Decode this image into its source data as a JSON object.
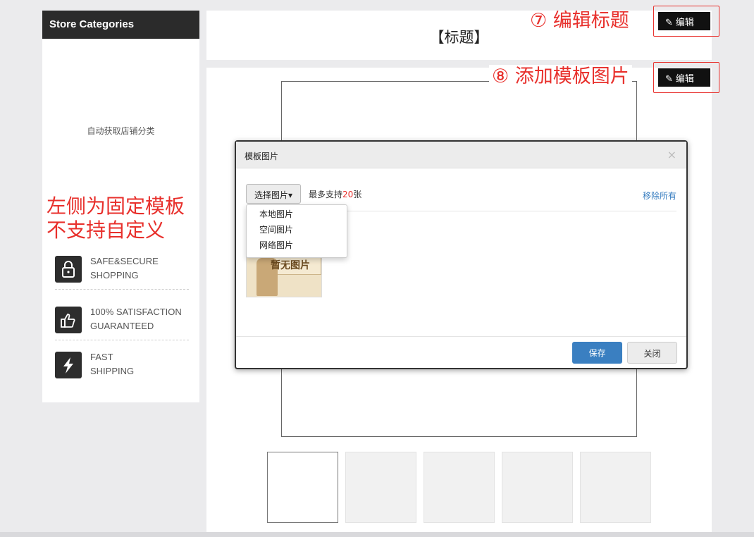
{
  "sidebar": {
    "header": "Store Categories",
    "auto_text": "自动获取店铺分类",
    "features": [
      {
        "line1": "SAFE&SECURE",
        "line2": "SHOPPING",
        "icon": "lock-icon"
      },
      {
        "line1": "100% SATISFACTION",
        "line2": "GUARANTEED",
        "icon": "thumbs-up-icon"
      },
      {
        "line1": "FAST",
        "line2": "SHIPPING",
        "icon": "lightning-icon"
      }
    ]
  },
  "annotations": {
    "left_note_line1": "左侧为固定模板",
    "left_note_line2": "不支持自定义",
    "edit_title_note": "⑦ 编辑标题",
    "add_image_note": "⑧ 添加模板图片"
  },
  "main": {
    "title": "【标题】",
    "edit_label": "编辑",
    "thumbnail_count": 5
  },
  "modal": {
    "title": "模板图片",
    "close_symbol": "×",
    "select_button": "选择图片▾",
    "max_prefix": "最多支持",
    "max_number": "20",
    "max_suffix": "张",
    "remove_all": "移除所有",
    "dropdown": [
      "本地图片",
      "空间图片",
      "网络图片"
    ],
    "no_image_label": "暂无图片",
    "save": "保存",
    "close": "关闭"
  },
  "colors": {
    "annotation_red": "#e8302c",
    "primary_blue": "#3a7fc1",
    "sidebar_header": "#2b2b2b"
  }
}
